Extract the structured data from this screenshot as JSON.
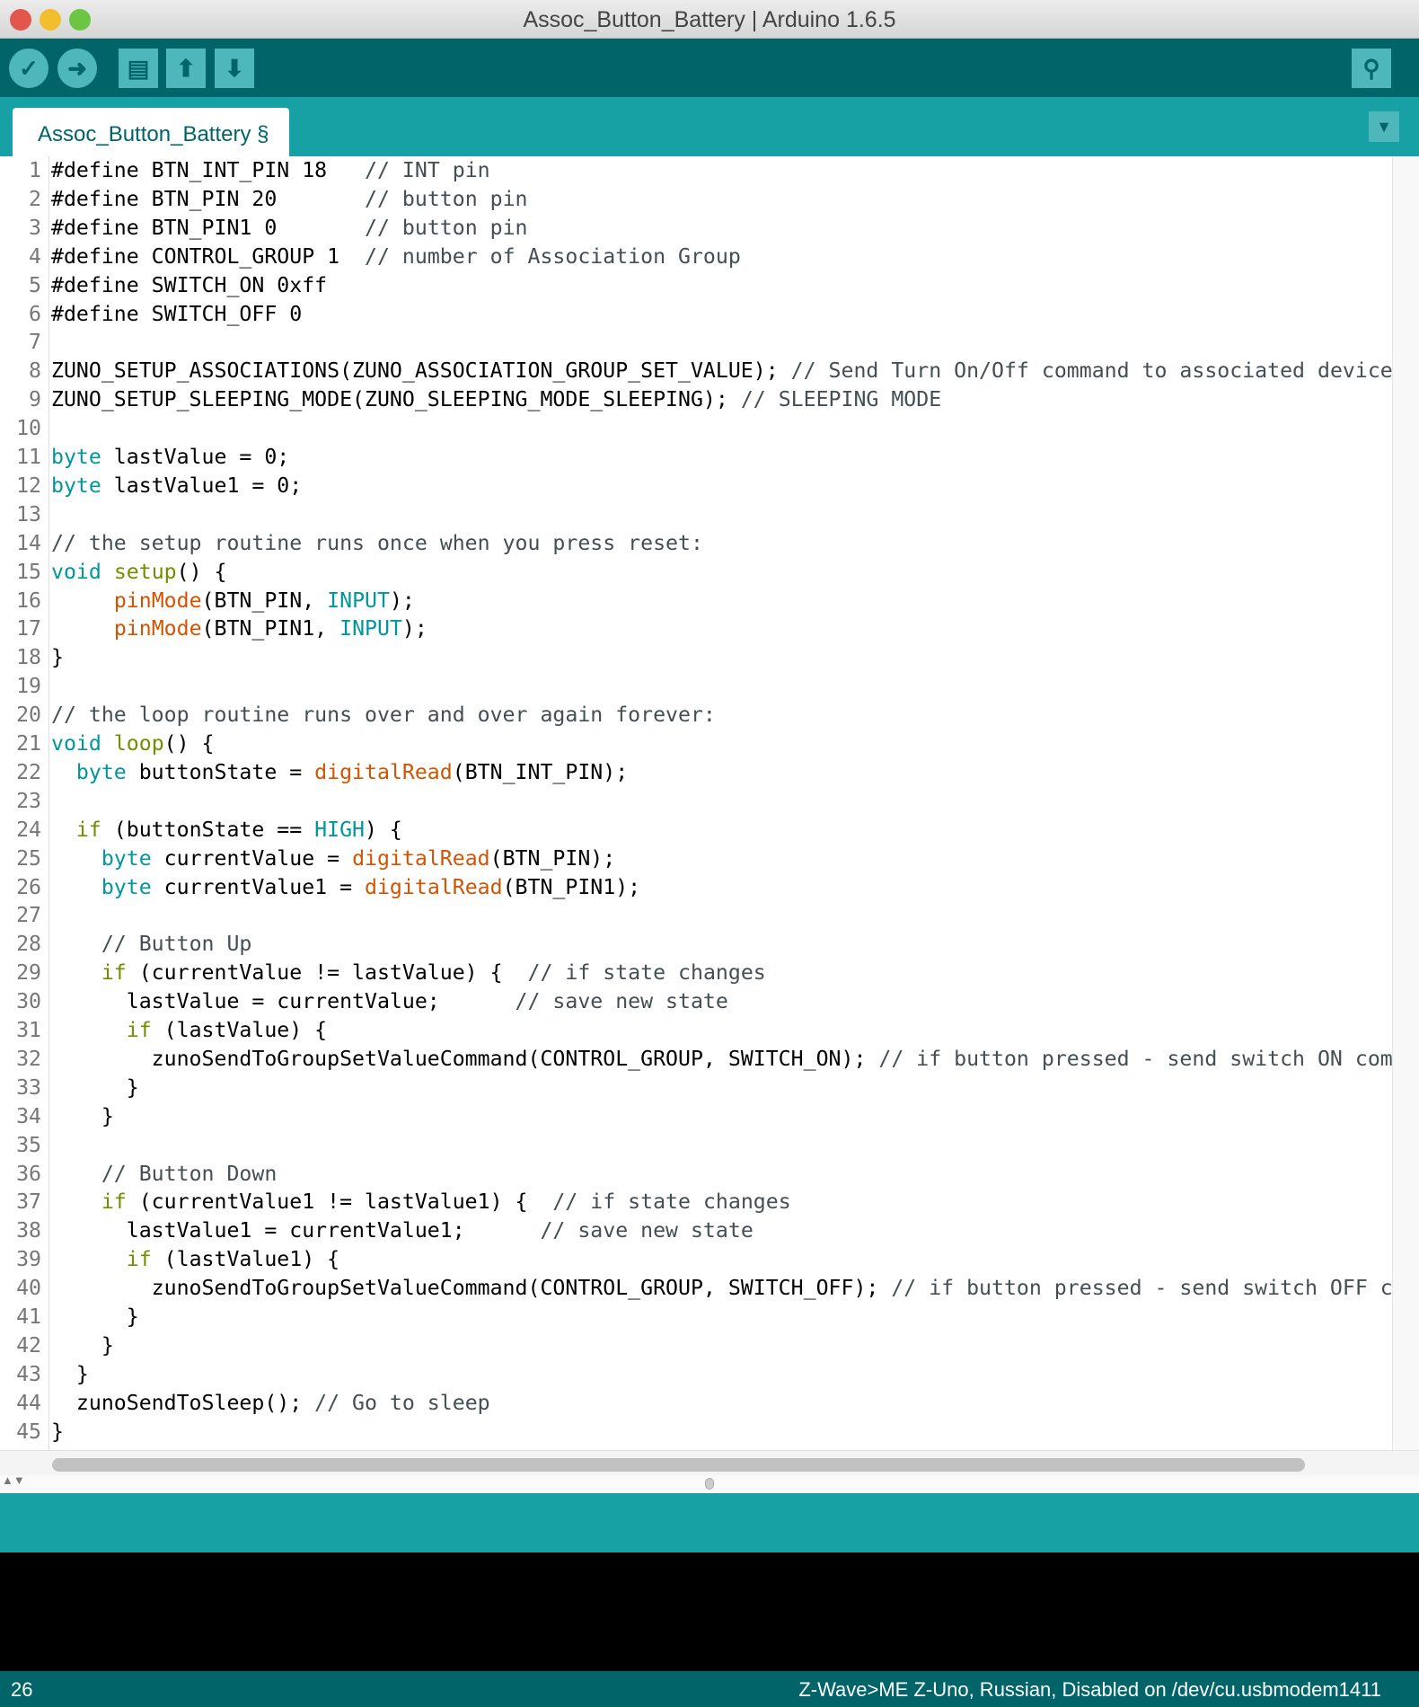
{
  "window": {
    "title": "Assoc_Button_Battery | Arduino 1.6.5",
    "colors": {
      "close": "#e2574c",
      "minimize": "#f2be2e",
      "zoom": "#6cc644"
    }
  },
  "toolbar": {
    "buttons": [
      {
        "name": "verify",
        "icon": "checkmark-icon",
        "glyph": "✓"
      },
      {
        "name": "upload",
        "icon": "arrow-right-icon",
        "glyph": "➜"
      },
      {
        "name": "new",
        "icon": "new-file-icon",
        "glyph": "▤"
      },
      {
        "name": "open",
        "icon": "arrow-up-icon",
        "glyph": "⬆"
      },
      {
        "name": "save",
        "icon": "arrow-down-icon",
        "glyph": "⬇"
      }
    ],
    "serial_monitor": {
      "icon": "magnifier-icon",
      "glyph": "⚲"
    },
    "colors": {
      "toolbar": "#006468",
      "tabbar": "#17a1a5",
      "button": "#4db7bb"
    }
  },
  "tabs": [
    {
      "label": "Assoc_Button_Battery §"
    }
  ],
  "tab_menu": {
    "icon": "triangle-down-icon",
    "glyph": "▼"
  },
  "editor": {
    "lines": [
      [
        [
          "",
          "#define BTN_INT_PIN 18   "
        ],
        [
          "c",
          "// INT pin"
        ]
      ],
      [
        [
          "",
          "#define BTN_PIN 20       "
        ],
        [
          "c",
          "// button pin"
        ]
      ],
      [
        [
          "",
          "#define BTN_PIN1 0       "
        ],
        [
          "c",
          "// button pin"
        ]
      ],
      [
        [
          "",
          "#define CONTROL_GROUP 1  "
        ],
        [
          "c",
          "// number of Association Group"
        ]
      ],
      [
        [
          "",
          "#define SWITCH_ON 0xff"
        ]
      ],
      [
        [
          "",
          "#define SWITCH_OFF 0"
        ]
      ],
      [],
      [
        [
          "",
          "ZUNO_SETUP_ASSOCIATIONS(ZUNO_ASSOCIATION_GROUP_SET_VALUE); "
        ],
        [
          "c",
          "// Send Turn On/Off command to associated device"
        ]
      ],
      [
        [
          "",
          "ZUNO_SETUP_SLEEPING_MODE(ZUNO_SLEEPING_MODE_SLEEPING); "
        ],
        [
          "c",
          "// SLEEPING MODE"
        ]
      ],
      [],
      [
        [
          "k",
          "byte"
        ],
        [
          "",
          " lastValue = 0;"
        ]
      ],
      [
        [
          "k",
          "byte"
        ],
        [
          "",
          " lastValue1 = 0;"
        ]
      ],
      [],
      [
        [
          "c",
          "// the setup routine runs once when you press reset:"
        ]
      ],
      [
        [
          "k",
          "void"
        ],
        [
          "",
          " "
        ],
        [
          "o",
          "setup"
        ],
        [
          "",
          "() {"
        ]
      ],
      [
        [
          "",
          "     "
        ],
        [
          "f",
          "pinMode"
        ],
        [
          "",
          "(BTN_PIN, "
        ],
        [
          "k",
          "INPUT"
        ],
        [
          "",
          ");"
        ]
      ],
      [
        [
          "",
          "     "
        ],
        [
          "f",
          "pinMode"
        ],
        [
          "",
          "(BTN_PIN1, "
        ],
        [
          "k",
          "INPUT"
        ],
        [
          "",
          ");"
        ]
      ],
      [
        [
          "",
          "}"
        ]
      ],
      [],
      [
        [
          "c",
          "// the loop routine runs over and over again forever:"
        ]
      ],
      [
        [
          "k",
          "void"
        ],
        [
          "",
          " "
        ],
        [
          "o",
          "loop"
        ],
        [
          "",
          "() {"
        ]
      ],
      [
        [
          "",
          "  "
        ],
        [
          "k",
          "byte"
        ],
        [
          "",
          " buttonState = "
        ],
        [
          "f",
          "digitalRead"
        ],
        [
          "",
          "(BTN_INT_PIN);"
        ]
      ],
      [],
      [
        [
          "",
          "  "
        ],
        [
          "o",
          "if"
        ],
        [
          "",
          " (buttonState == "
        ],
        [
          "k",
          "HIGH"
        ],
        [
          "",
          ") {"
        ]
      ],
      [
        [
          "",
          "    "
        ],
        [
          "k",
          "byte"
        ],
        [
          "",
          " currentValue = "
        ],
        [
          "f",
          "digitalRead"
        ],
        [
          "",
          "(BTN_PIN);"
        ]
      ],
      [
        [
          "",
          "    "
        ],
        [
          "k",
          "byte"
        ],
        [
          "",
          " currentValue1 = "
        ],
        [
          "f",
          "digitalRead"
        ],
        [
          "",
          "(BTN_PIN1);"
        ]
      ],
      [],
      [
        [
          "",
          "    "
        ],
        [
          "c",
          "// Button Up"
        ]
      ],
      [
        [
          "",
          "    "
        ],
        [
          "o",
          "if"
        ],
        [
          "",
          " (currentValue != lastValue) {  "
        ],
        [
          "c",
          "// if state changes"
        ]
      ],
      [
        [
          "",
          "      lastValue = currentValue;      "
        ],
        [
          "c",
          "// save new state"
        ]
      ],
      [
        [
          "",
          "      "
        ],
        [
          "o",
          "if"
        ],
        [
          "",
          " (lastValue) {"
        ]
      ],
      [
        [
          "",
          "        zunoSendToGroupSetValueCommand(CONTROL_GROUP, SWITCH_ON); "
        ],
        [
          "c",
          "// if button pressed - send switch ON com"
        ]
      ],
      [
        [
          "",
          "      }"
        ]
      ],
      [
        [
          "",
          "    }"
        ]
      ],
      [],
      [
        [
          "",
          "    "
        ],
        [
          "c",
          "// Button Down"
        ]
      ],
      [
        [
          "",
          "    "
        ],
        [
          "o",
          "if"
        ],
        [
          "",
          " (currentValue1 != lastValue1) {  "
        ],
        [
          "c",
          "// if state changes"
        ]
      ],
      [
        [
          "",
          "      lastValue1 = currentValue1;      "
        ],
        [
          "c",
          "// save new state"
        ]
      ],
      [
        [
          "",
          "      "
        ],
        [
          "o",
          "if"
        ],
        [
          "",
          " (lastValue1) {"
        ]
      ],
      [
        [
          "",
          "        zunoSendToGroupSetValueCommand(CONTROL_GROUP, SWITCH_OFF); "
        ],
        [
          "c",
          "// if button pressed - send switch OFF c"
        ]
      ],
      [
        [
          "",
          "      }"
        ]
      ],
      [
        [
          "",
          "    }"
        ]
      ],
      [
        [
          "",
          "  }"
        ]
      ],
      [
        [
          "",
          "  zunoSendToSleep(); "
        ],
        [
          "c",
          "// Go to sleep"
        ]
      ],
      [
        [
          "",
          "}"
        ]
      ]
    ],
    "syntax_colors": {
      "keyword": "#00979c",
      "function": "#d35400",
      "control": "#728e00",
      "comment": "#434f54"
    }
  },
  "status": {
    "line": "26",
    "board": "Z-Wave>ME Z-Uno, Russian, Disabled on /dev/cu.usbmodem1411"
  }
}
